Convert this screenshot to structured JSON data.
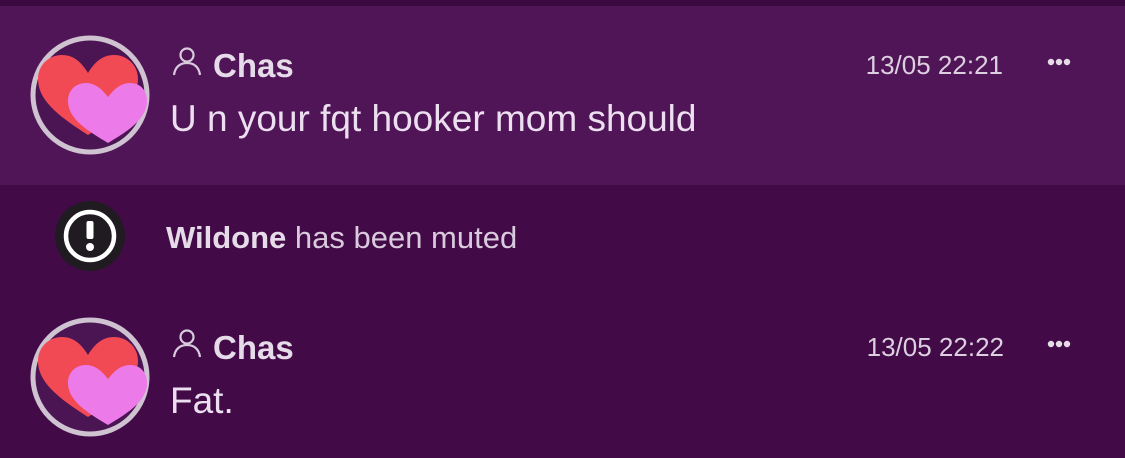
{
  "messages": [
    {
      "author": "Chas",
      "timestamp": "13/05 22:21",
      "text": "U n your fqt hooker mom should",
      "avatar_icon": "hearts-avatar-icon",
      "more_icon": "ellipsis-icon"
    },
    {
      "author": "Chas",
      "timestamp": "13/05 22:22",
      "text": "Fat.",
      "avatar_icon": "hearts-avatar-icon",
      "more_icon": "ellipsis-icon"
    }
  ],
  "system_notice": {
    "subject": "Wildone",
    "action": " has been muted",
    "icon": "exclamation-circle-icon"
  },
  "colors": {
    "background": "#420b47",
    "highlight": "#501556",
    "heart_red": "#f24a55",
    "heart_pink": "#ec7be9",
    "avatar_ring": "#cfc3d2"
  }
}
